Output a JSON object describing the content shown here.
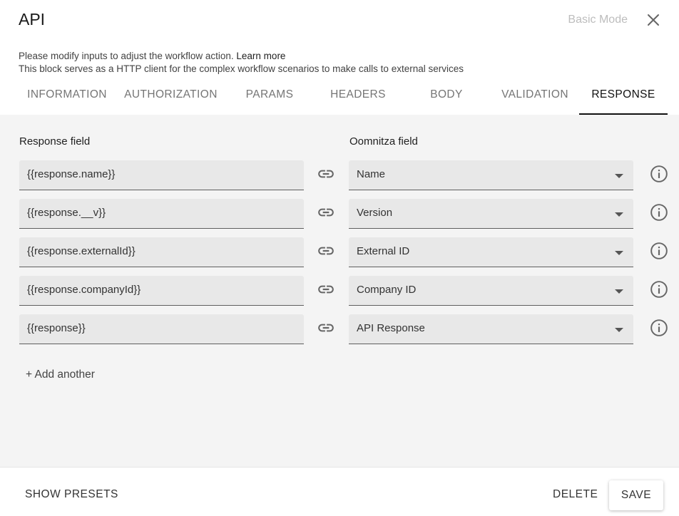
{
  "dialog": {
    "title": "API",
    "mode_toggle": "Basic Mode",
    "description_line1": "Please modify inputs to adjust the workflow action. ",
    "learn_more": "Learn more",
    "description_line2": "This block serves as a HTTP client for the complex workflow scenarios to make calls to external services"
  },
  "tabs": [
    {
      "label": "INFORMATION"
    },
    {
      "label": "AUTHORIZATION"
    },
    {
      "label": "PARAMS"
    },
    {
      "label": "HEADERS"
    },
    {
      "label": "BODY"
    },
    {
      "label": "VALIDATION"
    },
    {
      "label": "RESPONSE",
      "active": true
    }
  ],
  "mapping": {
    "response_label": "Response field",
    "oomnitza_label": "Oomnitza field",
    "rows": [
      {
        "response": "{{response.name}}",
        "oomnitza": "Name"
      },
      {
        "response": "{{response.__v}}",
        "oomnitza": "Version"
      },
      {
        "response": "{{response.externalId}}",
        "oomnitza": "External ID"
      },
      {
        "response": "{{response.companyId}}",
        "oomnitza": "Company ID"
      },
      {
        "response": "{{response}}",
        "oomnitza": "API Response"
      }
    ],
    "add_another": "+ Add another"
  },
  "footer": {
    "show_presets": "SHOW PRESETS",
    "delete": "DELETE",
    "save": "SAVE"
  }
}
